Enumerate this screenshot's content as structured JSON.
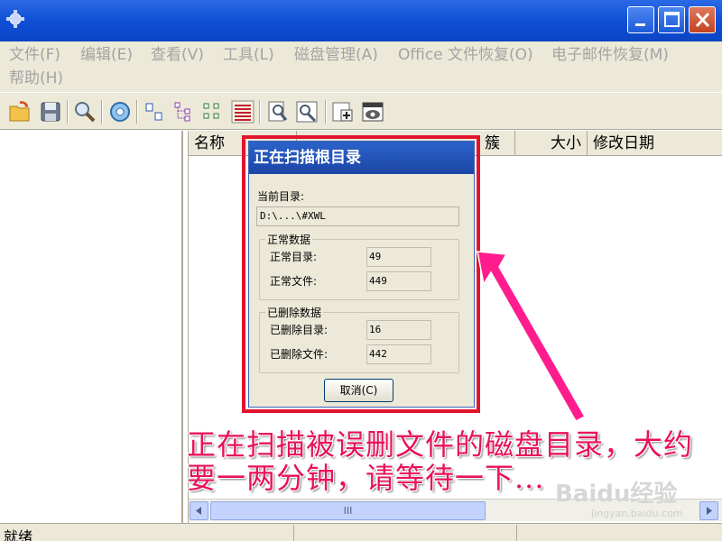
{
  "menu": {
    "file": "文件(F)",
    "edit": "编辑(E)",
    "view": "查看(V)",
    "tools": "工具(L)",
    "disk": "磁盘管理(A)",
    "office": "Office 文件恢复(O)",
    "email": "电子邮件恢复(M)",
    "help": "帮助(H)"
  },
  "columns": {
    "name": "名称",
    "cluster": "簇",
    "size": "大小",
    "modified": "修改日期"
  },
  "dialog": {
    "title": "正在扫描根目录",
    "current_dir_label": "当前目录:",
    "current_dir_value": "D:\\...\\#XWL",
    "normal_group": "正常数据",
    "normal_dir_label": "正常目录:",
    "normal_dir_value": "49",
    "normal_file_label": "正常文件:",
    "normal_file_value": "449",
    "deleted_group": "已删除数据",
    "deleted_dir_label": "已删除目录:",
    "deleted_dir_value": "16",
    "deleted_file_label": "已删除文件:",
    "deleted_file_value": "442",
    "cancel": "取消(C)"
  },
  "caption": {
    "line1": "正在扫描被误删文件的磁盘目录，大约",
    "line2": "要一两分钟，请等待一下..."
  },
  "scrollbar": {
    "thumb": "III"
  },
  "status": {
    "text": "就绪"
  },
  "watermark": {
    "logo": "Baidu经验",
    "url": "jingyan.baidu.com"
  },
  "colors": {
    "highlight": "#e2142e",
    "caption": "#e8125a",
    "titlebar": "#0f4fd6"
  }
}
